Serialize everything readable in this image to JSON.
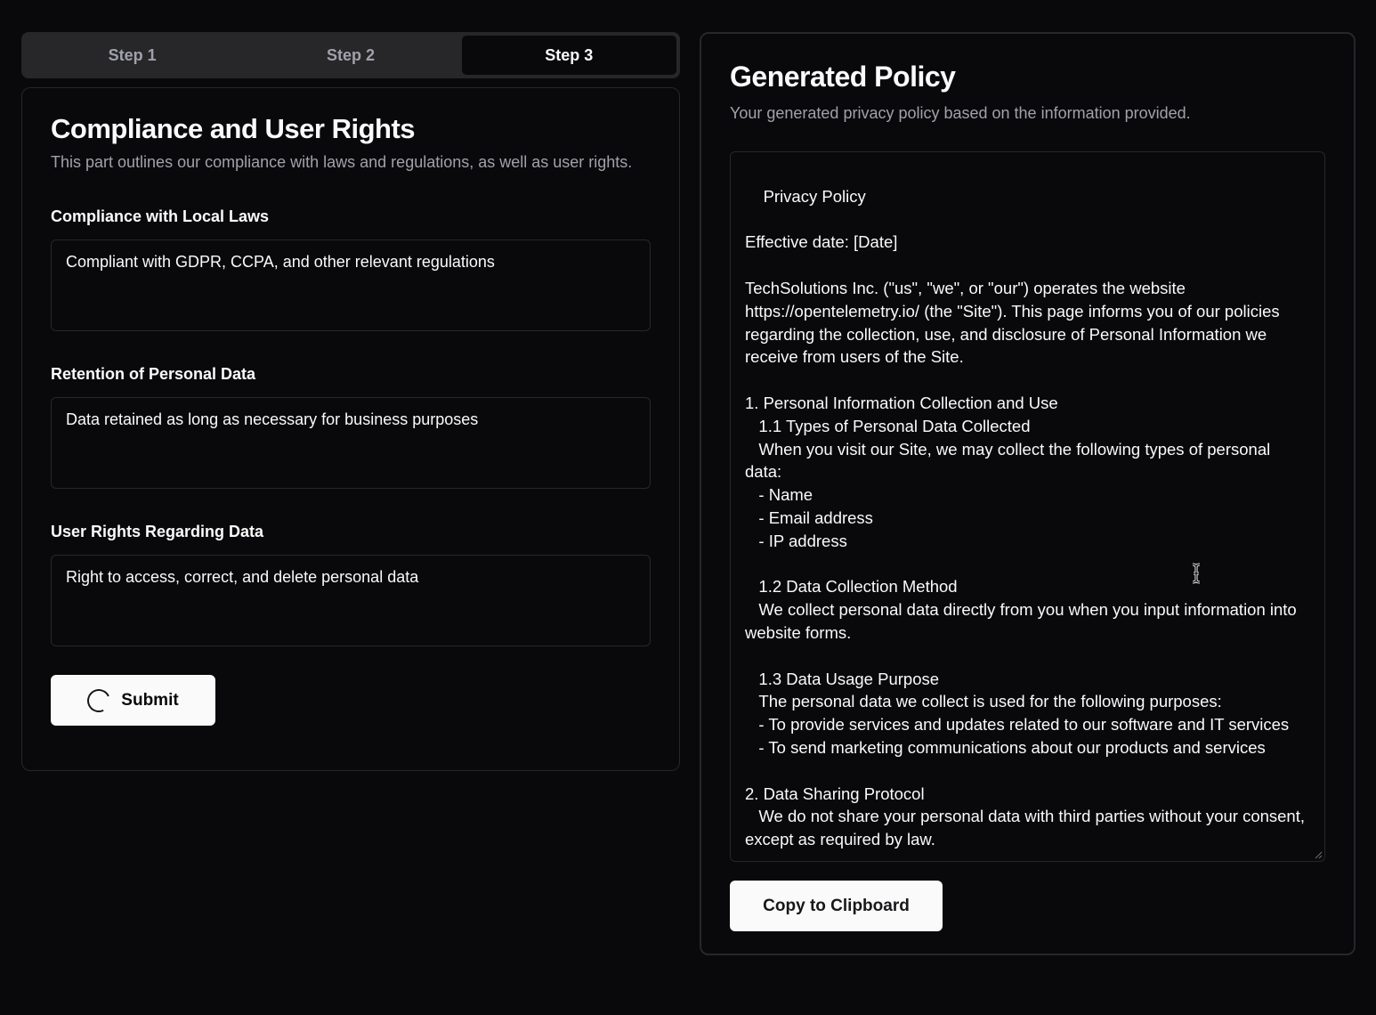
{
  "steps": {
    "tabs": [
      {
        "label": "Step 1",
        "active": false
      },
      {
        "label": "Step 2",
        "active": false
      },
      {
        "label": "Step 3",
        "active": true
      }
    ]
  },
  "form": {
    "title": "Compliance and User Rights",
    "description": "This part outlines our compliance with laws and regulations, as well as user rights.",
    "fields": [
      {
        "label": "Compliance with Local Laws",
        "value": "Compliant with GDPR, CCPA, and other relevant regulations"
      },
      {
        "label": "Retention of Personal Data",
        "value": "Data retained as long as necessary for business purposes"
      },
      {
        "label": "User Rights Regarding Data",
        "value": "Right to access, correct, and delete personal data"
      }
    ],
    "submit_label": "Submit"
  },
  "policy": {
    "title": "Generated Policy",
    "description": "Your generated privacy policy based on the information provided.",
    "text": "Privacy Policy\n\nEffective date: [Date]\n\nTechSolutions Inc. (\"us\", \"we\", or \"our\") operates the website https://opentelemetry.io/ (the \"Site\"). This page informs you of our policies regarding the collection, use, and disclosure of Personal Information we receive from users of the Site.\n\n1. Personal Information Collection and Use\n   1.1 Types of Personal Data Collected\n   When you visit our Site, we may collect the following types of personal data:\n   - Name\n   - Email address\n   - IP address\n\n   1.2 Data Collection Method\n   We collect personal data directly from you when you input information into website forms.\n\n   1.3 Data Usage Purpose\n   The personal data we collect is used for the following purposes:\n   - To provide services and updates related to our software and IT services\n   - To send marketing communications about our products and services\n\n2. Data Sharing Protocol\n   We do not share your personal data with third parties without your consent, except as required by law.",
    "copy_label": "Copy to Clipboard"
  },
  "icons": {
    "spinner": "loading-spinner-icon",
    "cursor": "text-cursor-icon"
  }
}
